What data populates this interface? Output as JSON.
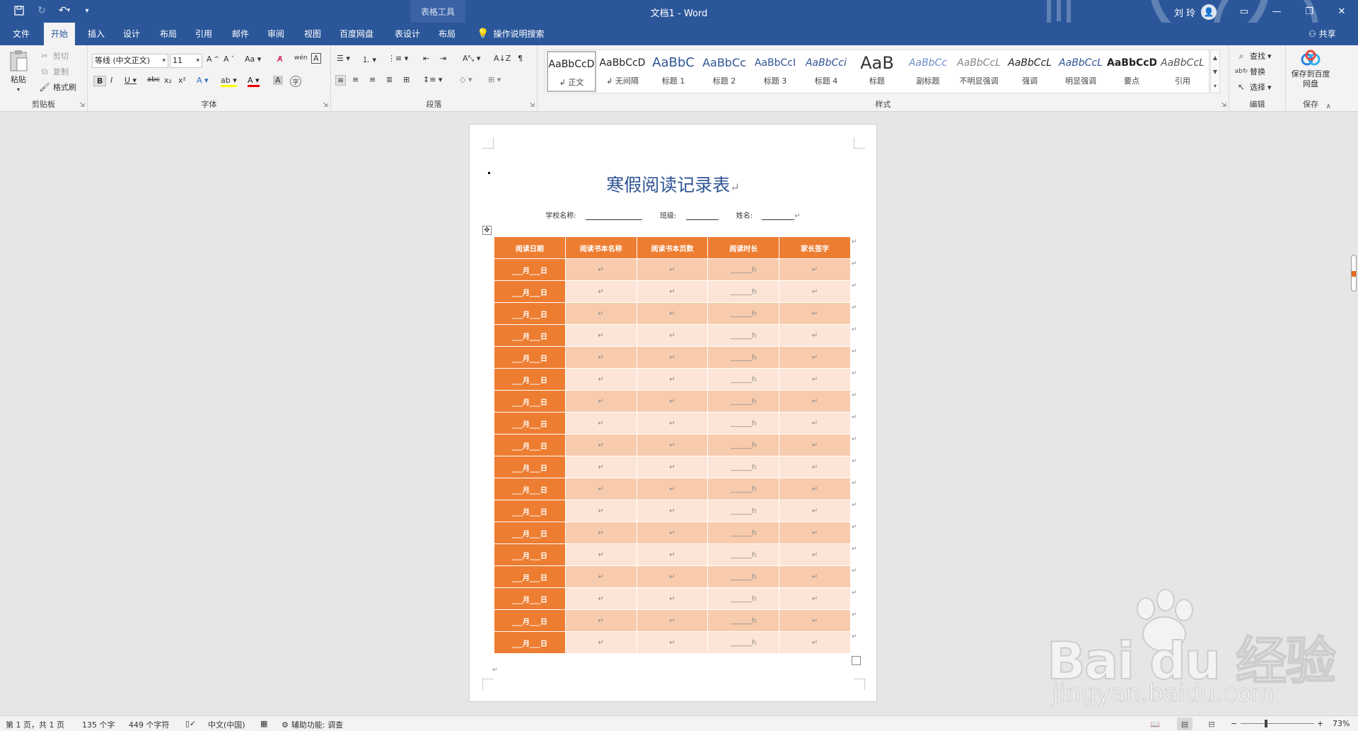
{
  "titlebar": {
    "context_tab": "表格工具",
    "document_title": "文档1  -  Word",
    "user_name": "刘 玲"
  },
  "tabs": [
    "文件",
    "开始",
    "插入",
    "设计",
    "布局",
    "引用",
    "邮件",
    "审阅",
    "视图",
    "百度网盘",
    "表设计",
    "布局"
  ],
  "active_tab": "开始",
  "tell_me": "操作说明搜索",
  "share": "共享",
  "clipboard": {
    "paste": "粘贴",
    "cut": "剪切",
    "copy": "复制",
    "format_painter": "格式刷",
    "label": "剪贴板"
  },
  "font": {
    "name": "等线 (中文正文)",
    "size": "11",
    "label": "字体"
  },
  "paragraph": {
    "label": "段落"
  },
  "styles": {
    "label": "样式",
    "items": [
      {
        "preview": "AaBbCcD",
        "name": "正文"
      },
      {
        "preview": "AaBbCcD",
        "name": "无间隔"
      },
      {
        "preview": "AaBbC",
        "name": "标题 1"
      },
      {
        "preview": "AaBbCc",
        "name": "标题 2"
      },
      {
        "preview": "AaBbCcI",
        "name": "标题 3"
      },
      {
        "preview": "AaBbCci",
        "name": "标题 4"
      },
      {
        "preview": "AaB",
        "name": "标题"
      },
      {
        "preview": "AaBbCc",
        "name": "副标题"
      },
      {
        "preview": "AaBbCcL",
        "name": "不明显强调"
      },
      {
        "preview": "AaBbCcL",
        "name": "强调"
      },
      {
        "preview": "AaBbCcL",
        "name": "明显强调"
      },
      {
        "preview": "AaBbCcD",
        "name": "要点"
      },
      {
        "preview": "AaBbCcL",
        "name": "引用"
      }
    ]
  },
  "editing": {
    "find": "查找",
    "replace": "替换",
    "select": "选择",
    "label": "编辑"
  },
  "save_group": {
    "button": "保存到百度网盘",
    "label": "保存"
  },
  "document": {
    "heading": "寒假阅读记录表",
    "pilcrow": "↵",
    "school_label": "学校名称:",
    "class_label": "班级:",
    "name_label": "姓名:",
    "table": {
      "headers": [
        "阅读日期",
        "阅读书本名称",
        "阅读书本页数",
        "阅读时长",
        "家长签字"
      ],
      "date_cell": "___月___日",
      "hours_cell": "______h",
      "empty_cell": "↵",
      "row_count": 18
    }
  },
  "statusbar": {
    "page": "第 1 页，共 1 页",
    "words": "135 个字",
    "chars": "449 个字符",
    "language": "中文(中国)",
    "accessibility": "辅助功能: 调查",
    "zoom": "73%"
  },
  "watermark": {
    "main": "Bai du 经验",
    "sub": "jingyan.baidu.com"
  },
  "colors": {
    "word_blue": "#2b579a",
    "table_header": "#ed7d31",
    "row_dark": "#f8cbad",
    "row_light": "#fce4d6",
    "heading": "#2f5496"
  }
}
